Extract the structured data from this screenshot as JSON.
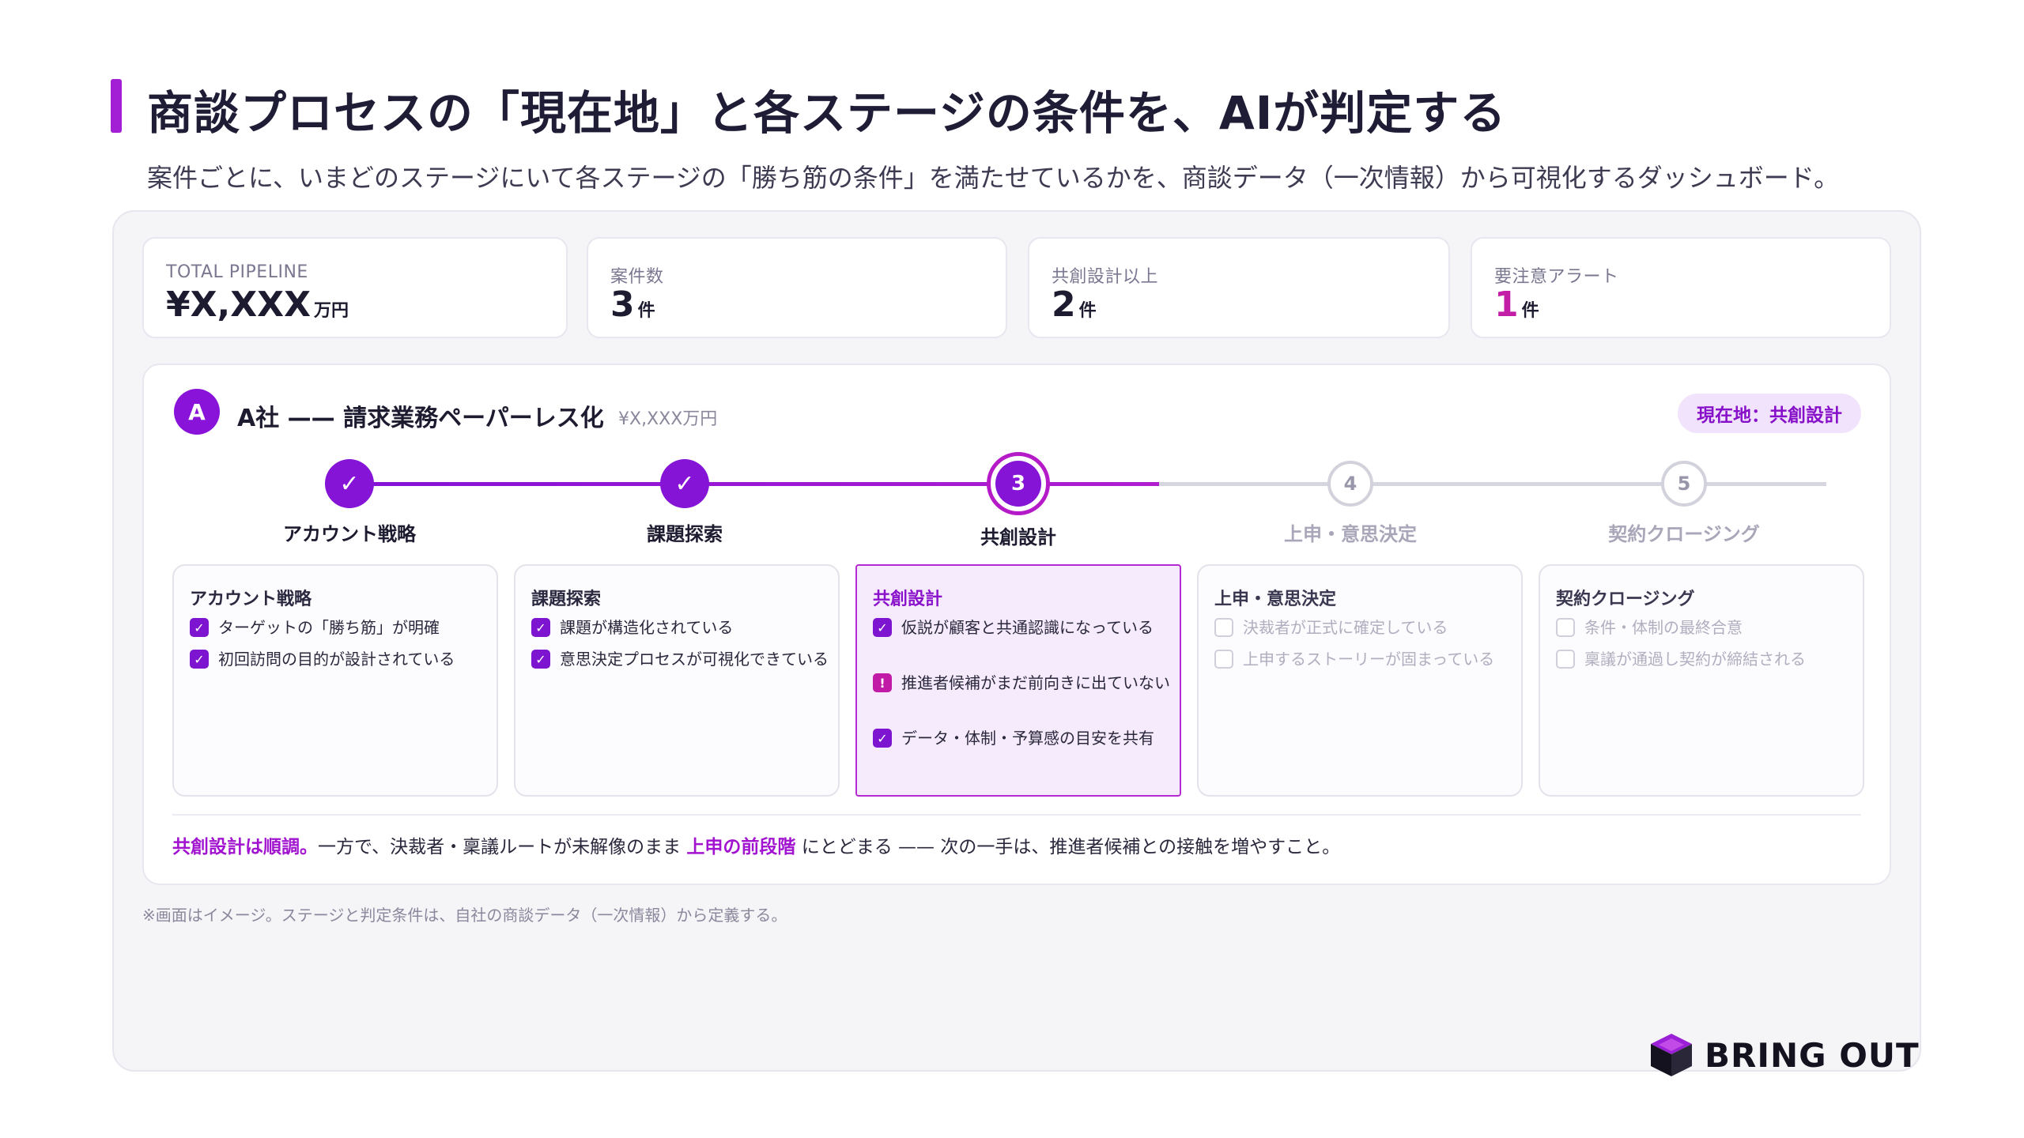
{
  "header": {
    "title": "商談プロセスの「現在地」と各ステージの条件を、AIが判定する",
    "subtitle": "案件ごとに、いまどのステージにいて各ステージの「勝ち筋の条件」を満たせているかを、商談データ（一次情報）から可視化するダッシュボード。"
  },
  "kpis": [
    {
      "label": "TOTAL PIPELINE",
      "value": "¥X,XXX",
      "unit": "万円"
    },
    {
      "label": "案件数",
      "value": "3",
      "unit": "件"
    },
    {
      "label": "共創設計以上",
      "value": "2",
      "unit": "件"
    },
    {
      "label": "要注意アラート",
      "value": "1",
      "unit": "件"
    }
  ],
  "deal": {
    "avatar": "A",
    "name": "A社 —— 請求業務ペーパーレス化",
    "amount": "¥X,XXX万円",
    "current_badge": "現在地：共創設計"
  },
  "stages": [
    {
      "label": "アカウント戦略",
      "status": "done",
      "marker": "✓",
      "criteria": [
        {
          "text": "ターゲットの「勝ち筋」が明確",
          "state": "check"
        },
        {
          "text": "初回訪問の目的が設計されている",
          "state": "check"
        }
      ]
    },
    {
      "label": "課題探索",
      "status": "done",
      "marker": "✓",
      "criteria": [
        {
          "text": "課題が構造化されている",
          "state": "check"
        },
        {
          "text": "意思決定プロセスが可視化できている",
          "state": "check"
        }
      ]
    },
    {
      "label": "共創設計",
      "status": "current",
      "marker": "3",
      "criteria": [
        {
          "text": "仮説が顧客と共通認識になっている",
          "state": "check"
        },
        {
          "text": "推進者候補がまだ前向きに出ていない",
          "state": "warn"
        },
        {
          "text": "データ・体制・予算感の目安を共有",
          "state": "check"
        }
      ]
    },
    {
      "label": "上申・意思決定",
      "status": "todo",
      "marker": "4",
      "criteria": [
        {
          "text": "決裁者が正式に確定している",
          "state": "empty"
        },
        {
          "text": "上申するストーリーが固まっている",
          "state": "empty"
        }
      ]
    },
    {
      "label": "契約クロージング",
      "status": "todo",
      "marker": "5",
      "criteria": [
        {
          "text": "条件・体制の最終合意",
          "state": "empty"
        },
        {
          "text": "稟議が通過し契約が締結される",
          "state": "empty"
        }
      ]
    }
  ],
  "summary": {
    "part1": "共創設計は順調。",
    "part2": "一方で、決裁者・稟議ルートが未解像のまま ",
    "part3": "上申の前段階",
    "part4": " にとどまる —— 次の一手は、推進者候補との接触を増やすこと。"
  },
  "footnote": "※画面はイメージ。ステージと判定条件は、自社の商談データ（一次情報）から定義する。",
  "brand": {
    "name": "BRING OUT",
    "accent": "#8514d6",
    "alert": "#c21ea7"
  }
}
